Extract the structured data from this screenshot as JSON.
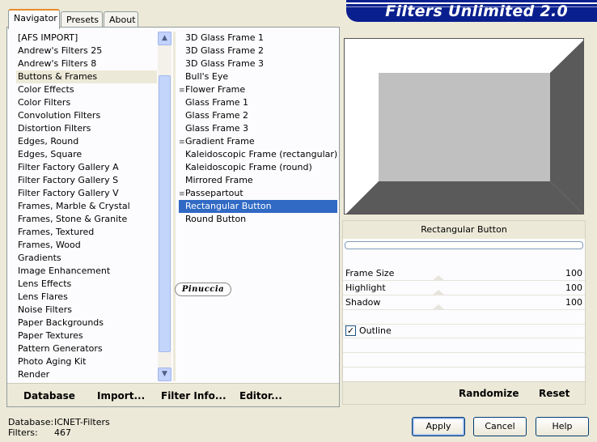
{
  "tabs": [
    {
      "label": "Navigator",
      "active": true
    },
    {
      "label": "Presets",
      "active": false
    },
    {
      "label": "About",
      "active": false
    }
  ],
  "banner": {
    "title": "Filters Unlimited 2.0",
    "color": "#0a1f8e"
  },
  "categories": [
    "[AFS IMPORT]",
    "Andrew's Filters 25",
    "Andrew's Filters 8",
    "Buttons & Frames",
    "Color Effects",
    "Color Filters",
    "Convolution Filters",
    "Distortion Filters",
    "Edges, Round",
    "Edges, Square",
    "Filter Factory Gallery A",
    "Filter Factory Gallery S",
    "Filter Factory Gallery V",
    "Frames, Marble & Crystal",
    "Frames, Stone & Granite",
    "Frames, Textured",
    "Frames, Wood",
    "Gradients",
    "Image Enhancement",
    "Lens Effects",
    "Lens Flares",
    "Noise Filters",
    "Paper Backgrounds",
    "Paper Textures",
    "Pattern Generators",
    "Photo Aging Kit",
    "Render"
  ],
  "selected_category_index": 3,
  "filters": [
    {
      "label": "3D Glass Frame 1",
      "marked": false
    },
    {
      "label": "3D Glass Frame 2",
      "marked": false
    },
    {
      "label": "3D Glass Frame 3",
      "marked": false
    },
    {
      "label": "Bull's Eye",
      "marked": false
    },
    {
      "label": "Flower Frame",
      "marked": true
    },
    {
      "label": "Glass Frame 1",
      "marked": false
    },
    {
      "label": "Glass Frame 2",
      "marked": false
    },
    {
      "label": "Glass Frame 3",
      "marked": false
    },
    {
      "label": "Gradient Frame",
      "marked": true
    },
    {
      "label": "Kaleidoscopic Frame (rectangular)",
      "marked": false
    },
    {
      "label": "Kaleidoscopic Frame (round)",
      "marked": false
    },
    {
      "label": "Mirrored Frame",
      "marked": false
    },
    {
      "label": "Passepartout",
      "marked": true
    },
    {
      "label": "Rectangular Button",
      "marked": false
    },
    {
      "label": "Round Button",
      "marked": false
    }
  ],
  "selected_filter_index": 13,
  "watermark": "Pinuccia",
  "bottom_links": {
    "database": "Database",
    "import": "Import...",
    "filter_info": "Filter Info...",
    "editor": "Editor..."
  },
  "filter_panel": {
    "title": "Rectangular Button",
    "params": [
      {
        "label": "Frame Size",
        "value": "100"
      },
      {
        "label": "Highlight",
        "value": "100"
      },
      {
        "label": "Shadow",
        "value": "100"
      }
    ],
    "outline": {
      "label": "Outline",
      "checked": true
    },
    "randomize": "Randomize",
    "reset": "Reset"
  },
  "status": {
    "database_label": "Database:",
    "database_value": "ICNET-Filters",
    "filters_label": "Filters:",
    "filters_value": "467"
  },
  "buttons": {
    "apply": "Apply",
    "cancel": "Cancel",
    "help": "Help"
  }
}
